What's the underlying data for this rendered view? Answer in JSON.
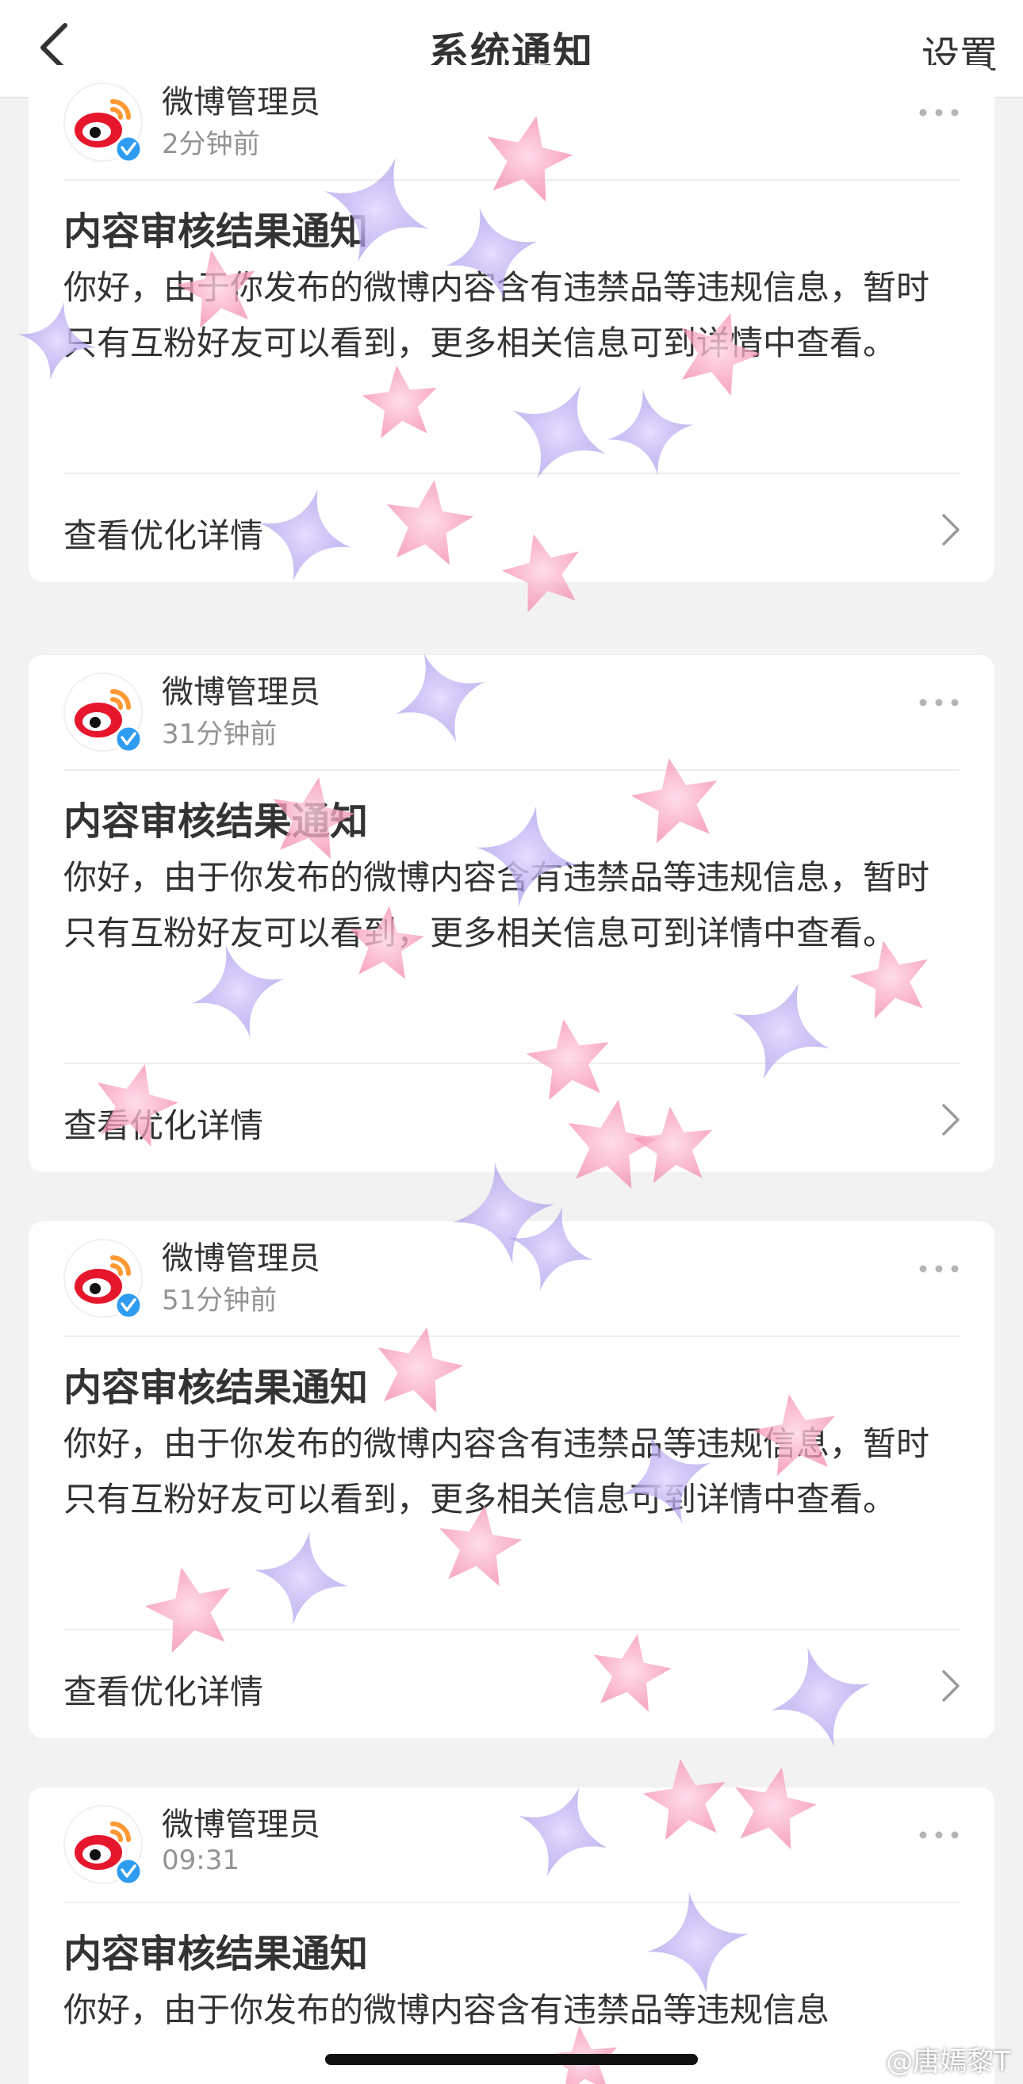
{
  "nav": {
    "title": "系统通知",
    "settings_label": "设置"
  },
  "notifications": [
    {
      "sender": "微博管理员",
      "time": "2分钟前",
      "title": "内容审核结果通知",
      "body": "你好，由于你发布的微博内容含有违禁品等违规信息，暂时只有互粉好友可以看到，更多相关信息可到详情中查看。",
      "detail_label": "查看优化详情"
    },
    {
      "sender": "微博管理员",
      "time": "31分钟前",
      "title": "内容审核结果通知",
      "body": "你好，由于你发布的微博内容含有违禁品等违规信息，暂时只有互粉好友可以看到，更多相关信息可到详情中查看。",
      "detail_label": "查看优化详情"
    },
    {
      "sender": "微博管理员",
      "time": "51分钟前",
      "title": "内容审核结果通知",
      "body": "你好，由于你发布的微博内容含有违禁品等违规信息，暂时只有互粉好友可以看到，更多相关信息可到详情中查看。",
      "detail_label": "查看优化详情"
    },
    {
      "sender": "微博管理员",
      "time": "09:31",
      "title": "内容审核结果通知",
      "body": "你好，由于你发布的微博内容含有违禁品等违规信息"
    }
  ],
  "watermark": "@唐嫣黎T",
  "colors": {
    "page_bg": "#f2f2f2",
    "card_bg": "#ffffff",
    "weibo_red": "#e6162d",
    "weibo_orange": "#ff9933",
    "verified_blue": "#2e9cf0",
    "muted_text": "#939393"
  },
  "icons": {
    "back": "chevron-left-icon",
    "avatar": "weibo-logo-icon",
    "verified": "verified-badge-icon",
    "more": "more-dots-icon",
    "detail": "chevron-right-icon"
  }
}
